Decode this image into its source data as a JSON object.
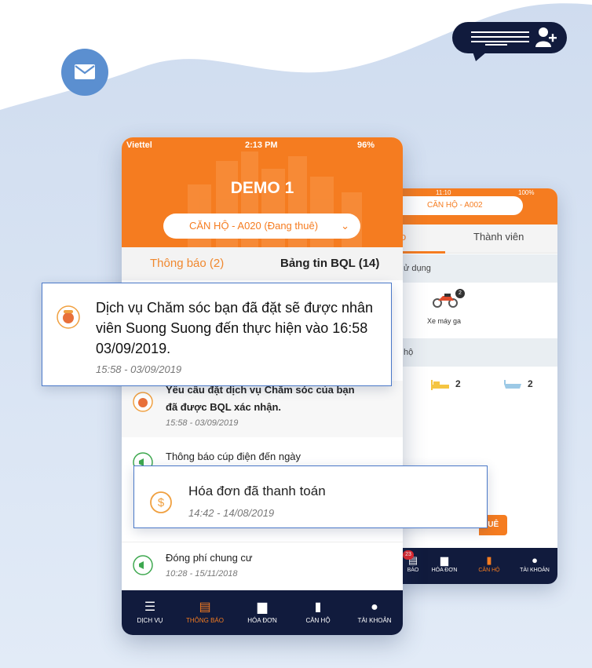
{
  "colors": {
    "accent": "#f57c20",
    "navy": "#111b3d",
    "blue": "#5b8fd0"
  },
  "front_phone": {
    "status": {
      "carrier": "Viettel",
      "time": "2:13 PM",
      "battery": "96%"
    },
    "title": "DEMO 1",
    "unit_select": "CĂN HỘ - A020 (Đang thuê)",
    "tabs": [
      {
        "label": "Thông báo (2)",
        "active": true
      },
      {
        "label": "Bảng tin BQL (14)",
        "active": false
      }
    ],
    "rows": [
      {
        "title_lines": [
          "Yêu cầu đặt dịch vụ Chăm sóc của bạn",
          "đã được BQL xác nhận."
        ],
        "time": "15:58 - 03/09/2019"
      },
      {
        "title_lines": [
          "Thông báo cúp điện đến ngày"
        ],
        "time": ""
      },
      {
        "title_lines": [
          "Đóng phí chung cư"
        ],
        "time": "10:28 - 15/11/2018"
      }
    ],
    "nav": [
      {
        "label": "DỊCH VỤ",
        "icon": "services-icon",
        "active": false
      },
      {
        "label": "THÔNG BÁO",
        "icon": "notification-icon",
        "active": true
      },
      {
        "label": "HÓA ĐƠN",
        "icon": "invoice-icon",
        "active": false
      },
      {
        "label": "CĂN HỘ",
        "icon": "apartment-icon",
        "active": false
      },
      {
        "label": "TÀI KHOẢN",
        "icon": "account-icon",
        "active": false
      }
    ]
  },
  "back_phone": {
    "status": {
      "time": "11:10",
      "battery": "100%"
    },
    "unit_select": "CĂN HỘ - A002",
    "tab_partial": "o",
    "tab_members": "Thành viên",
    "section_usage": "ử dụng",
    "vehicle": {
      "label": "Xe máy ga",
      "count": "2"
    },
    "section_apartment": "hộ",
    "bedrooms": "2",
    "bathrooms": "2",
    "button_partial": "HUÊ",
    "nav": [
      {
        "label": "BÁO",
        "badge": "23",
        "icon": "notification-icon",
        "active": false
      },
      {
        "label": "HÓA ĐƠN",
        "icon": "invoice-icon",
        "active": false
      },
      {
        "label": "CĂN HỘ",
        "icon": "apartment-icon",
        "active": true
      },
      {
        "label": "TÀI KHOẢN",
        "icon": "account-icon",
        "active": false
      }
    ]
  },
  "popup_service": {
    "text": "Dịch vụ Chăm sóc bạn đã đặt sẽ được nhân viên Suong Suong đến thực hiện vào 16:58 03/09/2019.",
    "time": "15:58 - 03/09/2019",
    "icon": "service-icon"
  },
  "popup_invoice": {
    "text": "Hóa đơn đã thanh toán",
    "time": "14:42 - 14/08/2019",
    "icon": "dollar-icon"
  }
}
